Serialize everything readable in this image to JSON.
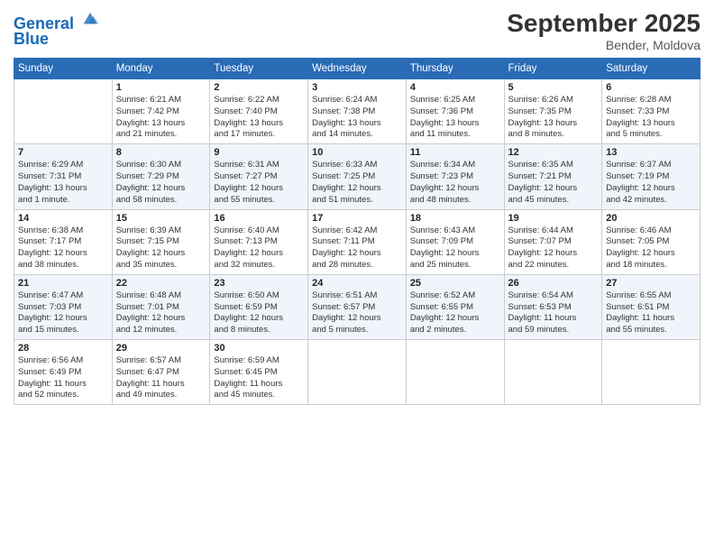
{
  "header": {
    "logo_line1": "General",
    "logo_line2": "Blue",
    "month_title": "September 2025",
    "location": "Bender, Moldova"
  },
  "weekdays": [
    "Sunday",
    "Monday",
    "Tuesday",
    "Wednesday",
    "Thursday",
    "Friday",
    "Saturday"
  ],
  "weeks": [
    [
      {
        "day": "",
        "info": ""
      },
      {
        "day": "1",
        "info": "Sunrise: 6:21 AM\nSunset: 7:42 PM\nDaylight: 13 hours\nand 21 minutes."
      },
      {
        "day": "2",
        "info": "Sunrise: 6:22 AM\nSunset: 7:40 PM\nDaylight: 13 hours\nand 17 minutes."
      },
      {
        "day": "3",
        "info": "Sunrise: 6:24 AM\nSunset: 7:38 PM\nDaylight: 13 hours\nand 14 minutes."
      },
      {
        "day": "4",
        "info": "Sunrise: 6:25 AM\nSunset: 7:36 PM\nDaylight: 13 hours\nand 11 minutes."
      },
      {
        "day": "5",
        "info": "Sunrise: 6:26 AM\nSunset: 7:35 PM\nDaylight: 13 hours\nand 8 minutes."
      },
      {
        "day": "6",
        "info": "Sunrise: 6:28 AM\nSunset: 7:33 PM\nDaylight: 13 hours\nand 5 minutes."
      }
    ],
    [
      {
        "day": "7",
        "info": "Sunrise: 6:29 AM\nSunset: 7:31 PM\nDaylight: 13 hours\nand 1 minute."
      },
      {
        "day": "8",
        "info": "Sunrise: 6:30 AM\nSunset: 7:29 PM\nDaylight: 12 hours\nand 58 minutes."
      },
      {
        "day": "9",
        "info": "Sunrise: 6:31 AM\nSunset: 7:27 PM\nDaylight: 12 hours\nand 55 minutes."
      },
      {
        "day": "10",
        "info": "Sunrise: 6:33 AM\nSunset: 7:25 PM\nDaylight: 12 hours\nand 51 minutes."
      },
      {
        "day": "11",
        "info": "Sunrise: 6:34 AM\nSunset: 7:23 PM\nDaylight: 12 hours\nand 48 minutes."
      },
      {
        "day": "12",
        "info": "Sunrise: 6:35 AM\nSunset: 7:21 PM\nDaylight: 12 hours\nand 45 minutes."
      },
      {
        "day": "13",
        "info": "Sunrise: 6:37 AM\nSunset: 7:19 PM\nDaylight: 12 hours\nand 42 minutes."
      }
    ],
    [
      {
        "day": "14",
        "info": "Sunrise: 6:38 AM\nSunset: 7:17 PM\nDaylight: 12 hours\nand 38 minutes."
      },
      {
        "day": "15",
        "info": "Sunrise: 6:39 AM\nSunset: 7:15 PM\nDaylight: 12 hours\nand 35 minutes."
      },
      {
        "day": "16",
        "info": "Sunrise: 6:40 AM\nSunset: 7:13 PM\nDaylight: 12 hours\nand 32 minutes."
      },
      {
        "day": "17",
        "info": "Sunrise: 6:42 AM\nSunset: 7:11 PM\nDaylight: 12 hours\nand 28 minutes."
      },
      {
        "day": "18",
        "info": "Sunrise: 6:43 AM\nSunset: 7:09 PM\nDaylight: 12 hours\nand 25 minutes."
      },
      {
        "day": "19",
        "info": "Sunrise: 6:44 AM\nSunset: 7:07 PM\nDaylight: 12 hours\nand 22 minutes."
      },
      {
        "day": "20",
        "info": "Sunrise: 6:46 AM\nSunset: 7:05 PM\nDaylight: 12 hours\nand 18 minutes."
      }
    ],
    [
      {
        "day": "21",
        "info": "Sunrise: 6:47 AM\nSunset: 7:03 PM\nDaylight: 12 hours\nand 15 minutes."
      },
      {
        "day": "22",
        "info": "Sunrise: 6:48 AM\nSunset: 7:01 PM\nDaylight: 12 hours\nand 12 minutes."
      },
      {
        "day": "23",
        "info": "Sunrise: 6:50 AM\nSunset: 6:59 PM\nDaylight: 12 hours\nand 8 minutes."
      },
      {
        "day": "24",
        "info": "Sunrise: 6:51 AM\nSunset: 6:57 PM\nDaylight: 12 hours\nand 5 minutes."
      },
      {
        "day": "25",
        "info": "Sunrise: 6:52 AM\nSunset: 6:55 PM\nDaylight: 12 hours\nand 2 minutes."
      },
      {
        "day": "26",
        "info": "Sunrise: 6:54 AM\nSunset: 6:53 PM\nDaylight: 11 hours\nand 59 minutes."
      },
      {
        "day": "27",
        "info": "Sunrise: 6:55 AM\nSunset: 6:51 PM\nDaylight: 11 hours\nand 55 minutes."
      }
    ],
    [
      {
        "day": "28",
        "info": "Sunrise: 6:56 AM\nSunset: 6:49 PM\nDaylight: 11 hours\nand 52 minutes."
      },
      {
        "day": "29",
        "info": "Sunrise: 6:57 AM\nSunset: 6:47 PM\nDaylight: 11 hours\nand 49 minutes."
      },
      {
        "day": "30",
        "info": "Sunrise: 6:59 AM\nSunset: 6:45 PM\nDaylight: 11 hours\nand 45 minutes."
      },
      {
        "day": "",
        "info": ""
      },
      {
        "day": "",
        "info": ""
      },
      {
        "day": "",
        "info": ""
      },
      {
        "day": "",
        "info": ""
      }
    ]
  ]
}
